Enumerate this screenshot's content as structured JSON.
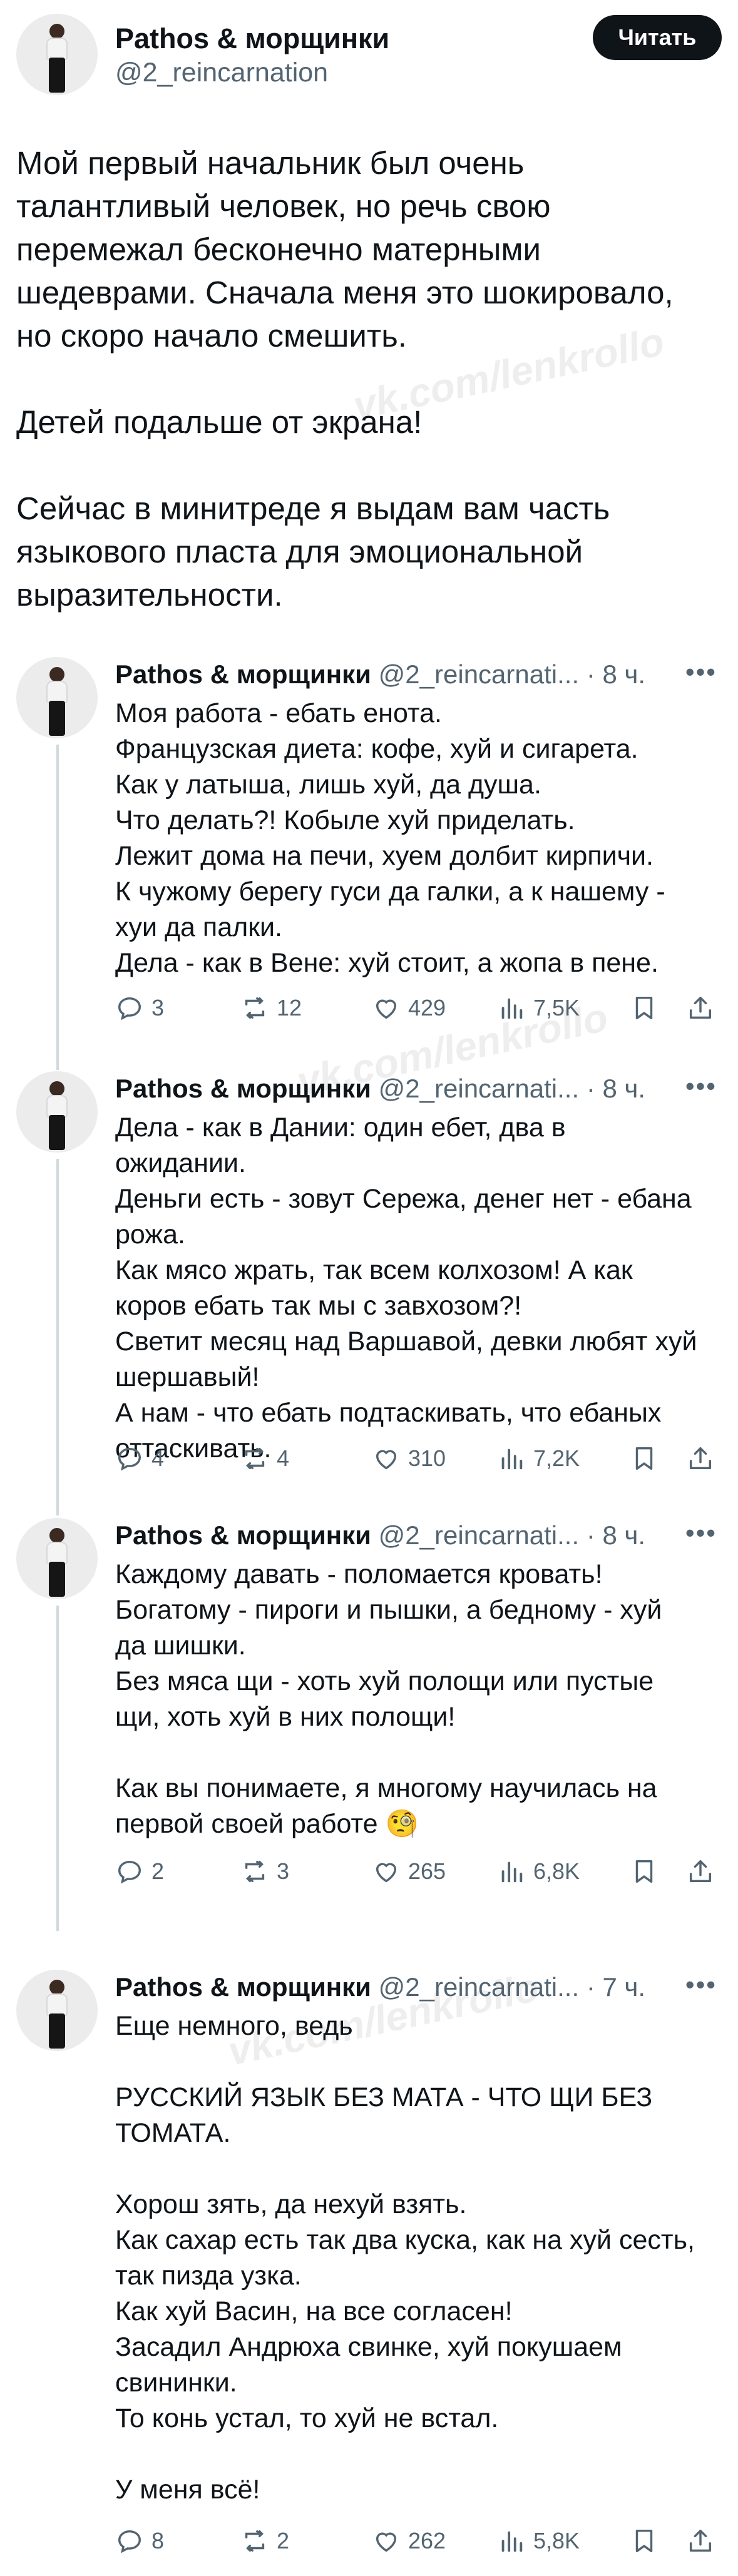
{
  "watermark": "vk.com/lenkrollo",
  "main": {
    "name": "Pathos & морщинки",
    "handle": "@2_reincarnation",
    "follow_label": "Читать",
    "paragraphs": [
      "Мой первый начальник был очень талантливый человек, но речь свою перемежал бесконечно матерными шедеврами. Сначала меня это шокировало, но скоро начало смешить.",
      "Детей подальше от экрана!",
      "Сейчас в минитреде я выдам вам часть языкового пласта для эмоциональной выразительности."
    ]
  },
  "replies": [
    {
      "name": "Pathos & морщинки",
      "handle": "@2_reincarnati...",
      "time": "8 ч.",
      "lines": [
        "Моя работа - ебать енота.",
        "Французская диета: кофе, хуй и сигарета.",
        "Как у латыша, лишь хуй, да душа.",
        "Что делать?! Кобыле хуй приделать.",
        "Лежит дома на печи, хуем долбит кирпичи.",
        "К чужому берегу гуси да галки, а к нашему - хуи да палки.",
        "Дела - как в Вене: хуй стоит, а жопа в пене."
      ],
      "replies": "3",
      "reposts": "12",
      "likes": "429",
      "views": "7,5K"
    },
    {
      "name": "Pathos & морщинки",
      "handle": "@2_reincarnati...",
      "time": "8 ч.",
      "lines": [
        "Дела - как в Дании: один ебет, два в ожидании.",
        "Деньги есть - зовут Сережа, денег нет - ебана рожа.",
        "Как мясо жрать, так всем колхозом! А как коров ебать так мы с завхозом?!",
        "Светит месяц над Варшавой, девки любят хуй шершавый!",
        "А нам - что ебать подтаскивать, что ебаных оттаскивать."
      ],
      "replies": "4",
      "reposts": "4",
      "likes": "310",
      "views": "7,2K"
    },
    {
      "name": "Pathos & морщинки",
      "handle": "@2_reincarnati...",
      "time": "8 ч.",
      "lines": [
        "Каждому давать - поломается кровать!",
        "Богатому - пироги и пышки, а бедному - хуй да шишки.",
        "Без мяса щи - хоть хуй полощи или пустые щи, хоть хуй в них полощи!",
        "Как вы понимаете, я многому научилась на первой своей работе 🧐"
      ],
      "replies": "2",
      "reposts": "3",
      "likes": "265",
      "views": "6,8K"
    },
    {
      "name": "Pathos & морщинки",
      "handle": "@2_reincarnati...",
      "time": "7 ч.",
      "lines": [
        "Еще немного, ведь",
        "РУССКИЙ ЯЗЫК БЕЗ МАТА - ЧТО ЩИ БЕЗ ТОМАТА.",
        "Хорош зять, да нехуй взять.",
        "Как сахар есть так два куска, как на хуй сесть, так пизда узка.",
        "Как хуй Васин, на все согласен!",
        "Засадил Андрюха свинке, хуй покушаем свининки.",
        "То конь устал, то хуй не встал.",
        "У меня всё!"
      ],
      "replies": "8",
      "reposts": "2",
      "likes": "262",
      "views": "5,8K"
    }
  ]
}
